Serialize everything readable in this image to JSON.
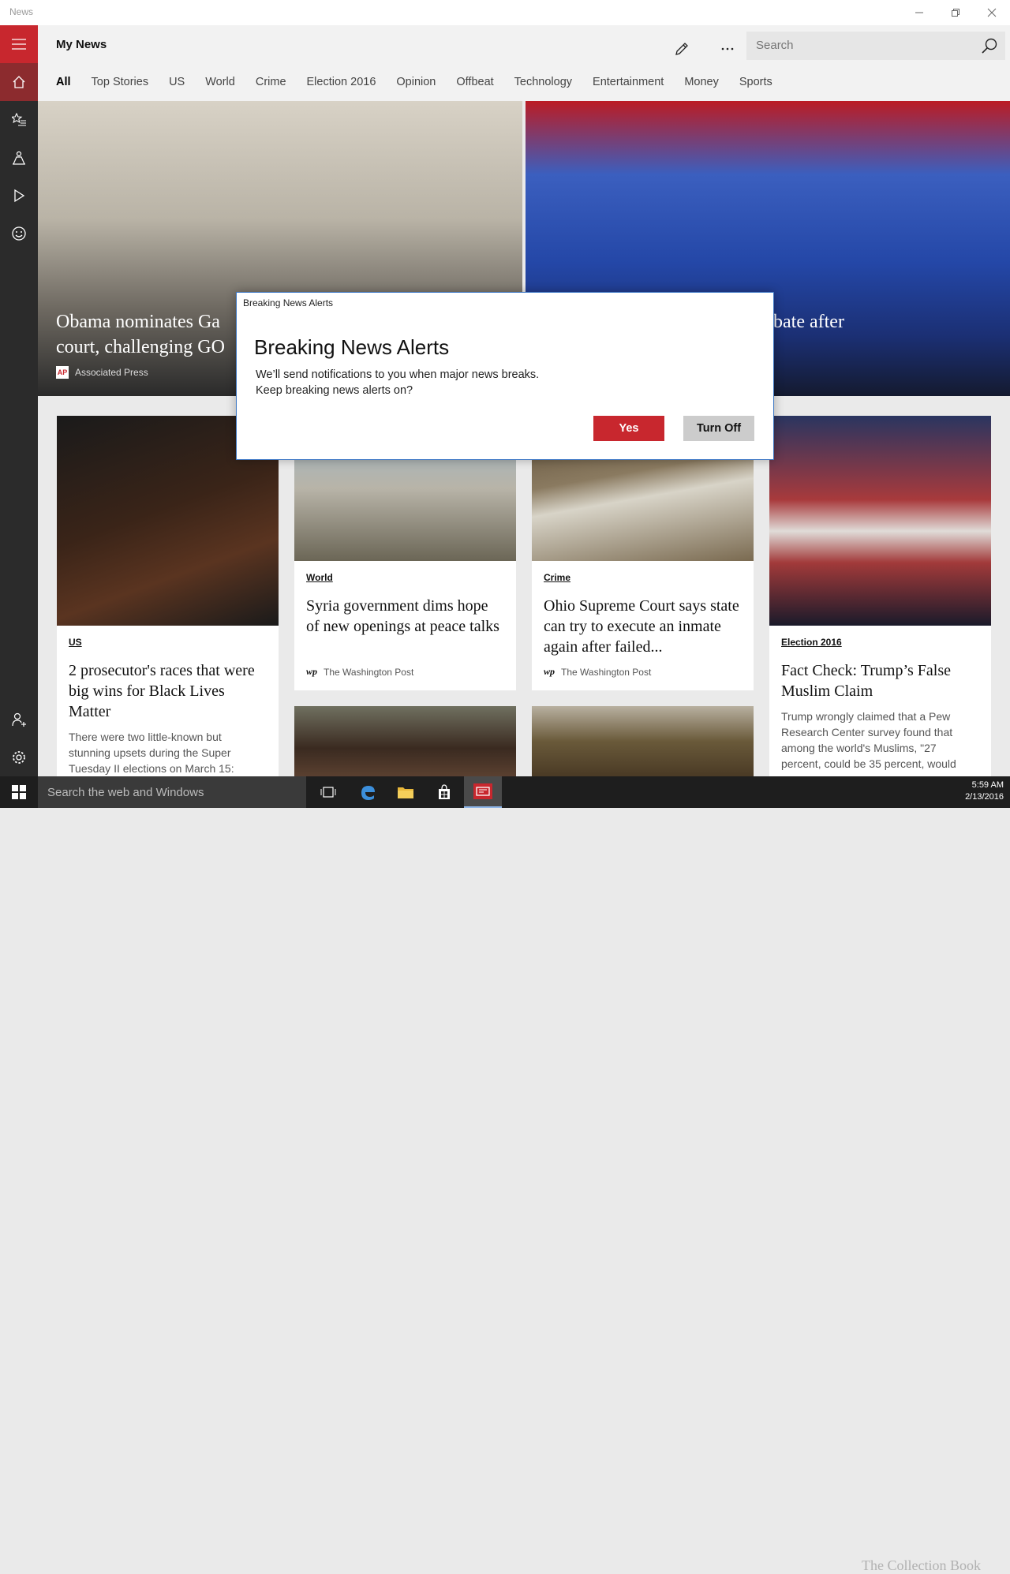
{
  "window": {
    "title": "News"
  },
  "header": {
    "title": "My News",
    "search_placeholder": "Search"
  },
  "tabs": [
    "All",
    "Top Stories",
    "US",
    "World",
    "Crime",
    "Election 2016",
    "Opinion",
    "Offbeat",
    "Technology",
    "Entertainment",
    "Money",
    "Sports"
  ],
  "hero": {
    "left": {
      "title_visible": "Obama nominates Ga",
      "title_line2_visible": "court, challenging GO",
      "source": "Associated Press",
      "source_logo": "AP"
    },
    "right": {
      "title_visible": "bate after"
    }
  },
  "cards": [
    {
      "category": "US",
      "title": "2 prosecutor's races that were big wins for Black Lives Matter",
      "desc": "There were two little-known but stunning upsets during the Super Tuesday II elections on March 15:"
    },
    {
      "category": "World",
      "title": "Syria government dims hope of new openings at peace talks",
      "source": "The Washington Post",
      "source_logo": "wp"
    },
    {
      "category": "Crime",
      "title": "Ohio Supreme Court says state can try to execute an inmate again after failed...",
      "source": "The Washington Post",
      "source_logo": "wp"
    },
    {
      "category": "Election 2016",
      "title": "Fact Check: Trump’s False Muslim Claim",
      "desc": "Trump wrongly claimed that a Pew Research Center survey found that among the world's Muslims, \"27 percent, could be 35 percent, would"
    }
  ],
  "dialog": {
    "window_title": "Breaking News Alerts",
    "heading": "Breaking News Alerts",
    "line1": "We’ll send notifications to you when major news breaks.",
    "line2": "Keep breaking news alerts on?",
    "yes_label": "Yes",
    "off_label": "Turn Off"
  },
  "taskbar": {
    "search_text": "Search the web and Windows",
    "time": "5:59 AM",
    "date": "2/13/2016"
  },
  "watermark": "The Collection Book",
  "colors": {
    "accent": "#c8272e",
    "nav_bg": "#2b2b2b",
    "taskbar_bg": "#1e1e1e"
  }
}
